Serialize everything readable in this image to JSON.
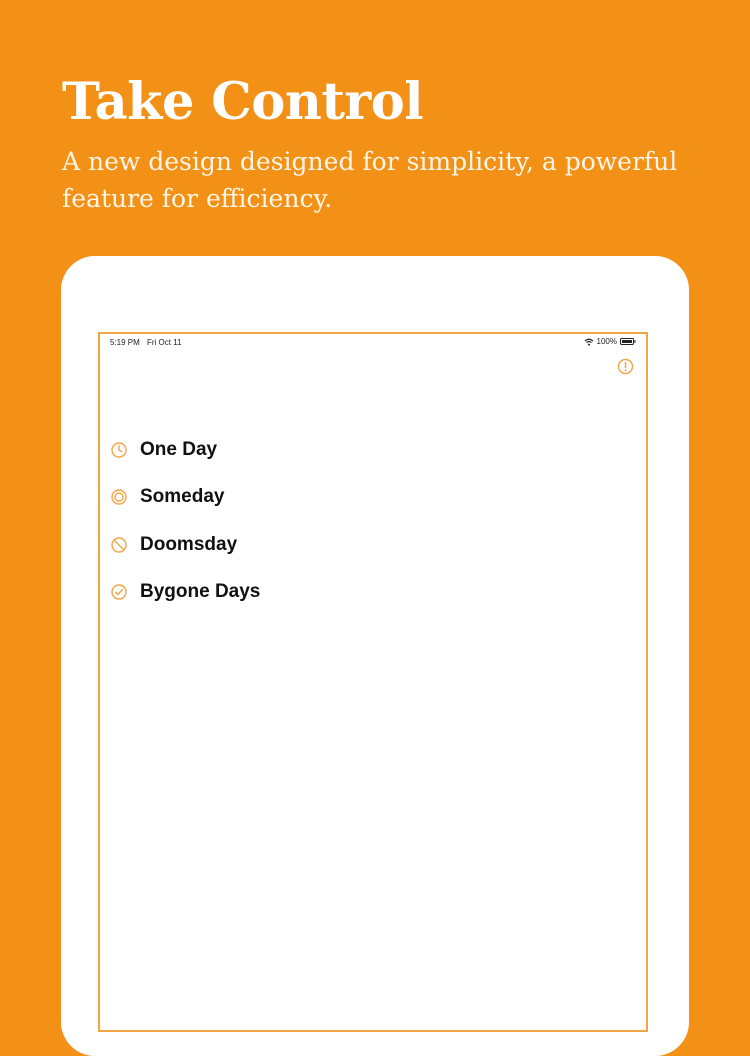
{
  "headline": "Take Control",
  "subhead": "A new design designed for simplicity, a powerful feature for efficiency.",
  "colors": {
    "background": "#F39117",
    "accent": "#F2A544"
  },
  "status_bar": {
    "time": "5:19 PM",
    "date": "Fri Oct 11",
    "battery": "100%"
  },
  "info_button": {
    "icon": "info-icon"
  },
  "list": [
    {
      "label": "One Day",
      "icon": "clock-icon"
    },
    {
      "label": "Someday",
      "icon": "target-icon"
    },
    {
      "label": "Doomsday",
      "icon": "prohibited-icon"
    },
    {
      "label": "Bygone Days",
      "icon": "checkmark-circle-icon"
    }
  ]
}
